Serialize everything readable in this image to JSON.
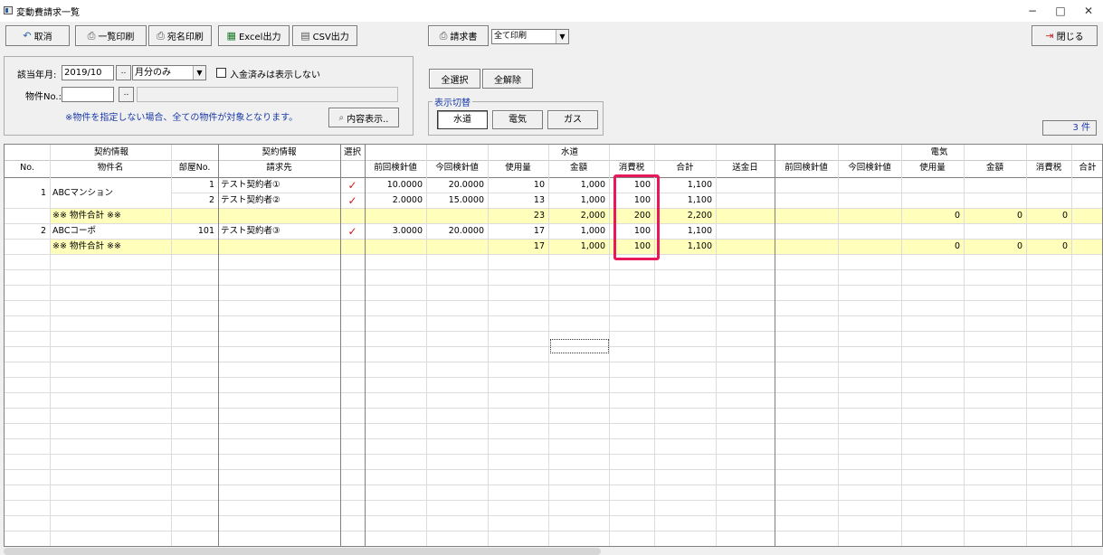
{
  "window": {
    "title": "変動費請求一覧",
    "controls": {
      "minimize": "−",
      "maximize": "□",
      "close": "✕"
    }
  },
  "toolbar": {
    "cancel": "取消",
    "list_print": "一覧印刷",
    "address_print": "宛名印刷",
    "excel": "Excel出力",
    "csv": "CSV出力",
    "invoice": "請求書",
    "print_mode": "全て印刷",
    "close": "閉じる",
    "icons": {
      "cancel": "undo-icon",
      "list_print": "printer-icon",
      "address_print": "printer-icon",
      "excel": "excel-icon",
      "csv": "csv-icon",
      "invoice": "printer-icon",
      "close": "exit-icon"
    }
  },
  "filters": {
    "month_label": "該当年月:",
    "month_value": "2019/10",
    "month_button": "..",
    "period_value": "月分のみ",
    "exclude_paid_label": "入金済みは表示しない",
    "exclude_paid_checked": false,
    "property_label": "物件No.:",
    "property_value": "",
    "property_button": "..",
    "note": "※物件を指定しない場合、全ての物件が対象となります。",
    "show_content": "内容表示.."
  },
  "selection": {
    "select_all": "全選択",
    "deselect_all": "全解除"
  },
  "display_switch": {
    "legend": "表示切替",
    "tabs": [
      "水道",
      "電気",
      "ガス"
    ],
    "active_tab": "水道"
  },
  "count": "3 件",
  "grid": {
    "group_headers": {
      "contract_info_1": "契約情報",
      "contract_info_2": "契約情報",
      "select": "選択",
      "water": "水道",
      "electricity": "電気"
    },
    "columns": {
      "no": "No.",
      "property_name": "物件名",
      "room_no": "部屋No.",
      "billing_to": "請求先",
      "w_prev": "前回検針値",
      "w_curr": "今回検針値",
      "w_usage": "使用量",
      "w_amount": "金額",
      "w_tax": "消費税",
      "w_total": "合計",
      "w_date": "送金日",
      "e_prev": "前回検針値",
      "e_curr": "今回検針値",
      "e_usage": "使用量",
      "e_amount": "金額",
      "e_tax": "消費税",
      "e_total": "合計"
    },
    "rows": [
      {
        "no": "1",
        "property_name": "ABCマンション",
        "room_no": "1",
        "billing_to": "テスト契約者①",
        "selected": "✓",
        "w_prev": "10.0000",
        "w_curr": "20.0000",
        "w_usage": "10",
        "w_amount": "1,000",
        "w_tax": "100",
        "w_total": "1,100",
        "e_usage": "",
        "e_amount": "",
        "e_tax": ""
      },
      {
        "no": "",
        "property_name": "",
        "room_no": "2",
        "billing_to": "テスト契約者②",
        "selected": "✓",
        "w_prev": "2.0000",
        "w_curr": "15.0000",
        "w_usage": "13",
        "w_amount": "1,000",
        "w_tax": "100",
        "w_total": "1,100",
        "e_usage": "",
        "e_amount": "",
        "e_tax": ""
      },
      {
        "no": "",
        "property_name": "※※ 物件合計 ※※",
        "room_no": "",
        "billing_to": "",
        "selected": "",
        "w_prev": "",
        "w_curr": "",
        "w_usage": "23",
        "w_amount": "2,000",
        "w_tax": "200",
        "w_total": "2,200",
        "e_usage": "0",
        "e_amount": "0",
        "e_tax": "0",
        "subtotal": true
      },
      {
        "no": "2",
        "property_name": "ABCコーポ",
        "room_no": "101",
        "billing_to": "テスト契約者③",
        "selected": "✓",
        "w_prev": "3.0000",
        "w_curr": "20.0000",
        "w_usage": "17",
        "w_amount": "1,000",
        "w_tax": "100",
        "w_total": "1,100",
        "e_usage": "",
        "e_amount": "",
        "e_tax": ""
      },
      {
        "no": "",
        "property_name": "※※ 物件合計 ※※",
        "room_no": "",
        "billing_to": "",
        "selected": "",
        "w_prev": "",
        "w_curr": "",
        "w_usage": "17",
        "w_amount": "1,000",
        "w_tax": "100",
        "w_total": "1,100",
        "e_usage": "0",
        "e_amount": "0",
        "e_tax": "0",
        "subtotal": true
      }
    ]
  },
  "colors": {
    "subtotal_row": "#ffffbb",
    "highlight": "#e8185a",
    "check": "#d01818",
    "note_text": "#1b3aa8"
  }
}
